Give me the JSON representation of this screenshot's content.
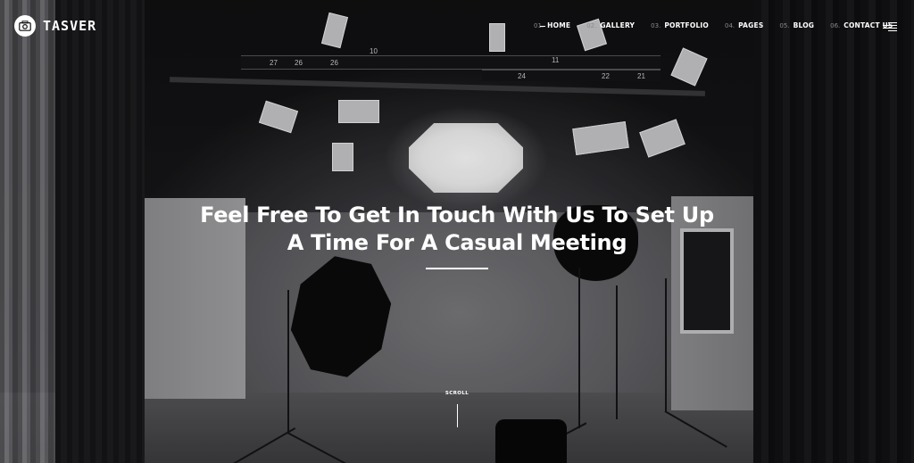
{
  "brand": {
    "name": "TASVER",
    "logo_icon": "camera-icon"
  },
  "nav": {
    "items": [
      {
        "num": "01.",
        "label": "HOME",
        "active": true
      },
      {
        "num": "02.",
        "label": "GALLERY",
        "active": false
      },
      {
        "num": "03.",
        "label": "PORTFOLIO",
        "active": false
      },
      {
        "num": "04.",
        "label": "PAGES",
        "active": false
      },
      {
        "num": "05.",
        "label": "BLOG",
        "active": false
      },
      {
        "num": "06.",
        "label": "CONTACT US",
        "active": false
      }
    ],
    "menu_icon": "hamburger-menu-icon"
  },
  "hero": {
    "title_line1": "Feel Free To Get In Touch With Us To Set Up",
    "title_line2": "A Time For A Casual Meeting"
  },
  "scroll": {
    "label": "SCROLL"
  },
  "background": {
    "truss_numbers": [
      "27",
      "26",
      "26",
      "10",
      "11",
      "22",
      "21",
      "24"
    ]
  },
  "colors": {
    "text": "#ffffff",
    "muted": "#8a8a8e",
    "background": "#0d0d0f"
  }
}
